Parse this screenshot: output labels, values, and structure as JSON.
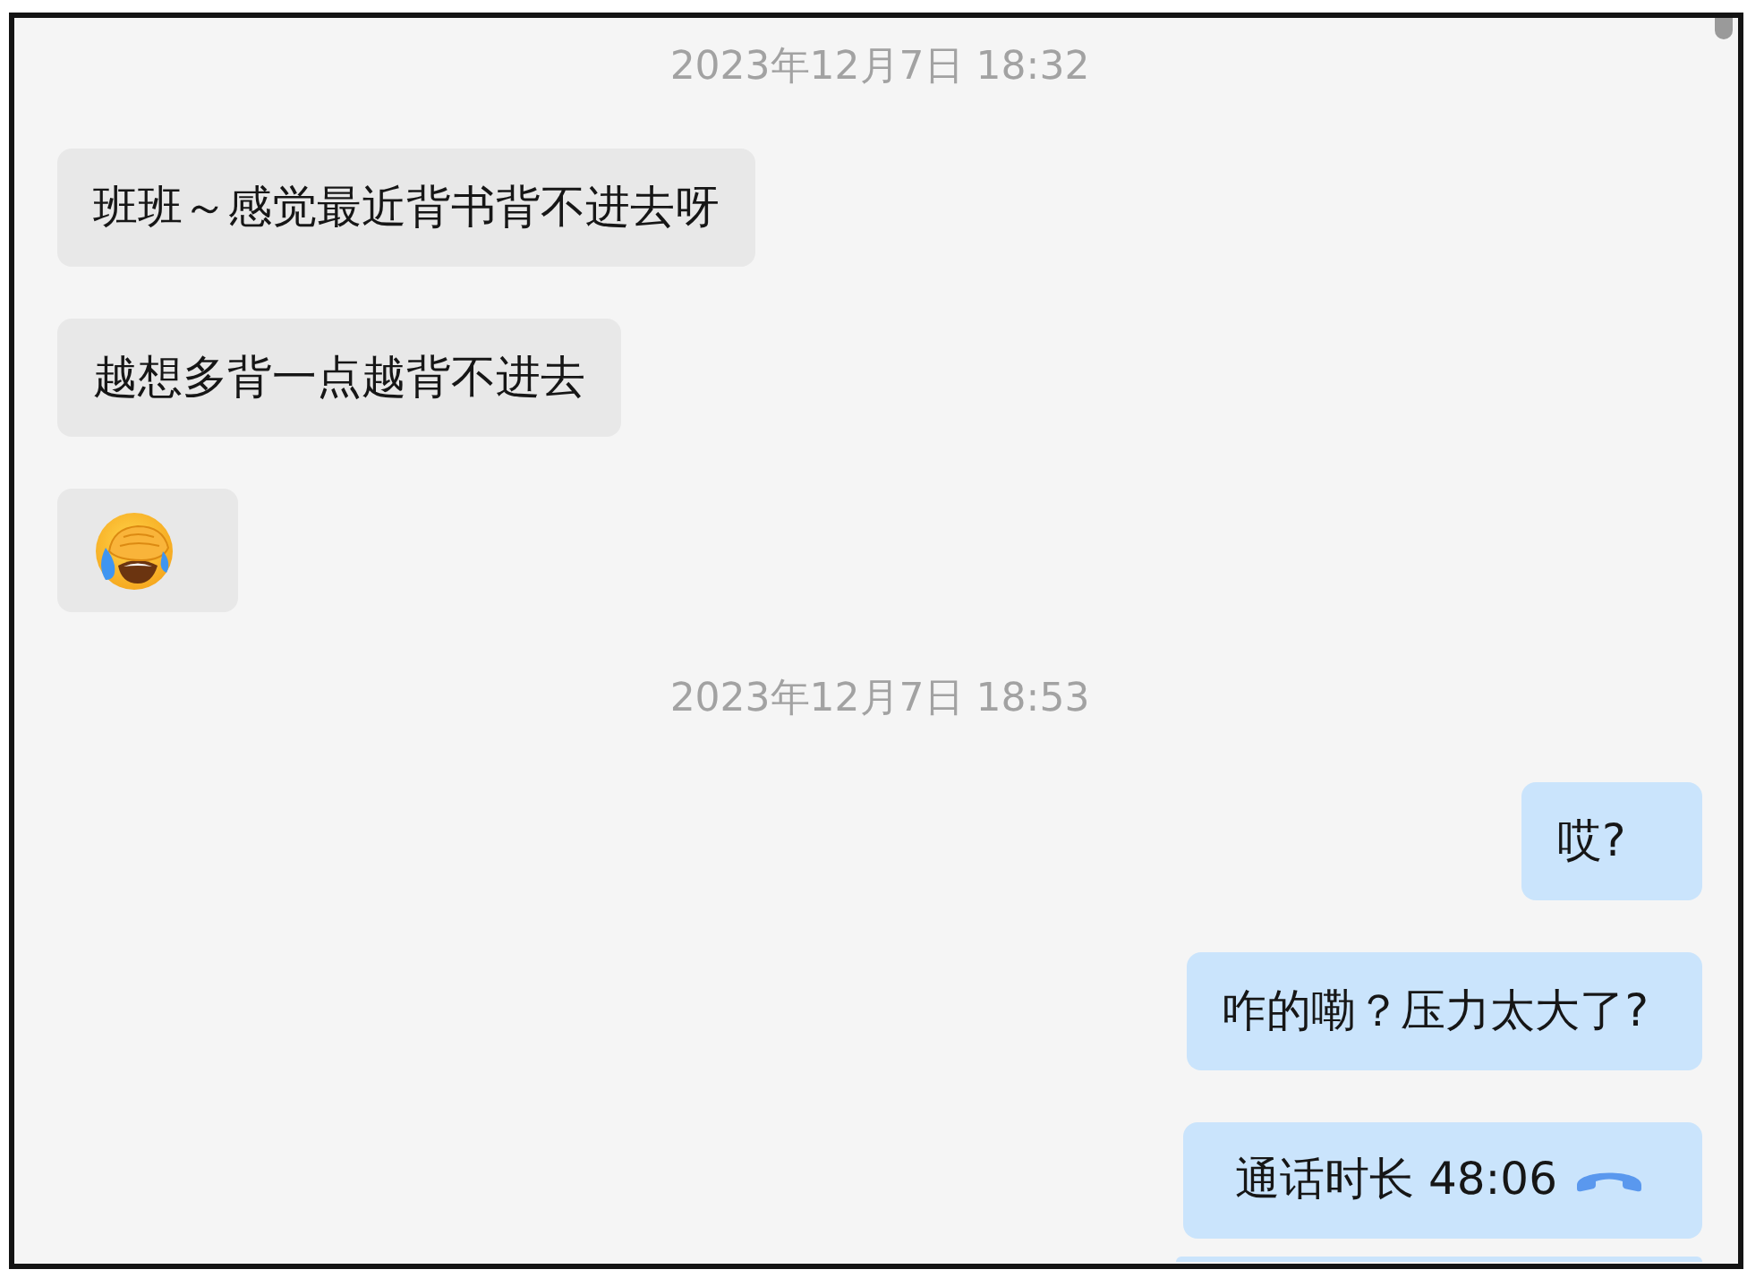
{
  "conversation": [
    {
      "kind": "timestamp",
      "text": "2023年12月7日 18:32"
    },
    {
      "kind": "text",
      "outgoing": false,
      "text": "班班～感觉最近背书背不进去呀"
    },
    {
      "kind": "text",
      "outgoing": false,
      "text": "越想多背一点越背不进去"
    },
    {
      "kind": "emoji",
      "outgoing": false
    },
    {
      "kind": "timestamp",
      "text": "2023年12月7日 18:53"
    },
    {
      "kind": "text",
      "outgoing": true,
      "text": "哎?"
    },
    {
      "kind": "text",
      "outgoing": true,
      "text": "咋的嘞？压力太大了?"
    },
    {
      "kind": "call",
      "outgoing": true,
      "text": "通话时长 48:06"
    },
    {
      "kind": "partial",
      "outgoing": true
    }
  ]
}
